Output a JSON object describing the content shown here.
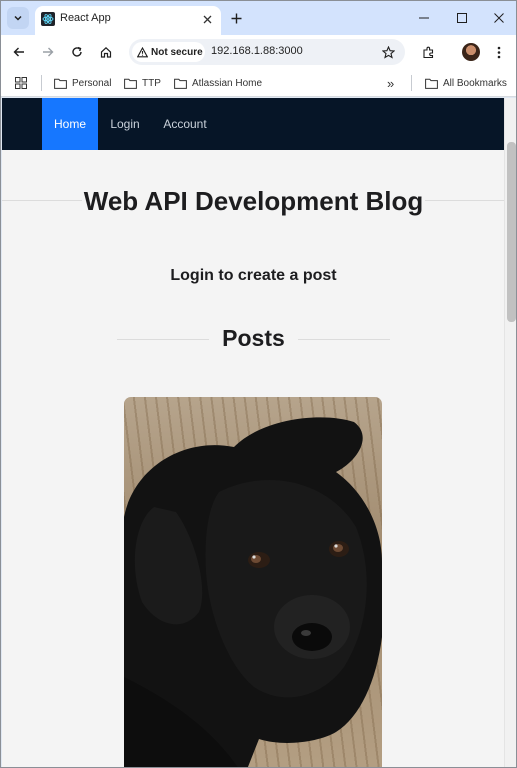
{
  "browser": {
    "tab_title": "React App",
    "security_label": "Not secure",
    "url": "192.168.1.88:3000",
    "bookmarks": [
      {
        "label": "Personal"
      },
      {
        "label": "TTP"
      },
      {
        "label": "Atlassian Home"
      }
    ],
    "all_bookmarks_label": "All Bookmarks",
    "overflow_label": "»"
  },
  "nav": {
    "items": [
      {
        "label": "Home",
        "active": true
      },
      {
        "label": "Login",
        "active": false
      },
      {
        "label": "Account",
        "active": false
      }
    ]
  },
  "page": {
    "site_title": "Web API Development Blog",
    "login_message": "Login to create a post",
    "posts_heading": "Posts"
  },
  "colors": {
    "navbar_bg": "#061527",
    "active_nav": "#1677ff",
    "page_bg": "#f4f4f4"
  }
}
